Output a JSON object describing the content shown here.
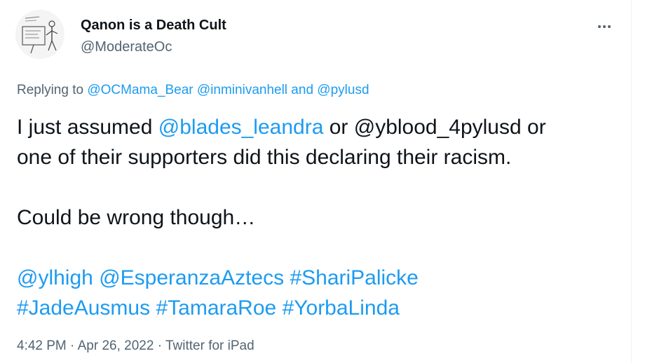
{
  "author": {
    "display_name": "Qanon is a Death Cult",
    "handle": "@ModerateOc"
  },
  "more_icon": "more-horizontal-icon",
  "reply": {
    "prefix": "Replying to ",
    "mentions": [
      "@OCMama_Bear",
      "@inminivanhell",
      "@pylusd"
    ],
    "joiner": " and "
  },
  "tweet": {
    "line1_prefix": "I just assumed ",
    "line1_mention": "@blades_leandra",
    "line1_suffix": " or @yblood_4pylusd or",
    "line2": "one of their supporters did this declaring their racism.",
    "line3": "Could be wrong though…",
    "tags_line1": [
      "@ylhigh",
      "@EsperanzaAztecs",
      "#ShariPalicke"
    ],
    "tags_line2": [
      "#JadeAusmus",
      "#TamaraRoe",
      "#YorbaLinda"
    ]
  },
  "meta": {
    "time": "4:42 PM",
    "date": "Apr 26, 2022",
    "source": "Twitter for iPad",
    "separator": " · "
  },
  "colors": {
    "link": "#1d9bf0",
    "secondary": "#536471",
    "text": "#0f1419"
  }
}
